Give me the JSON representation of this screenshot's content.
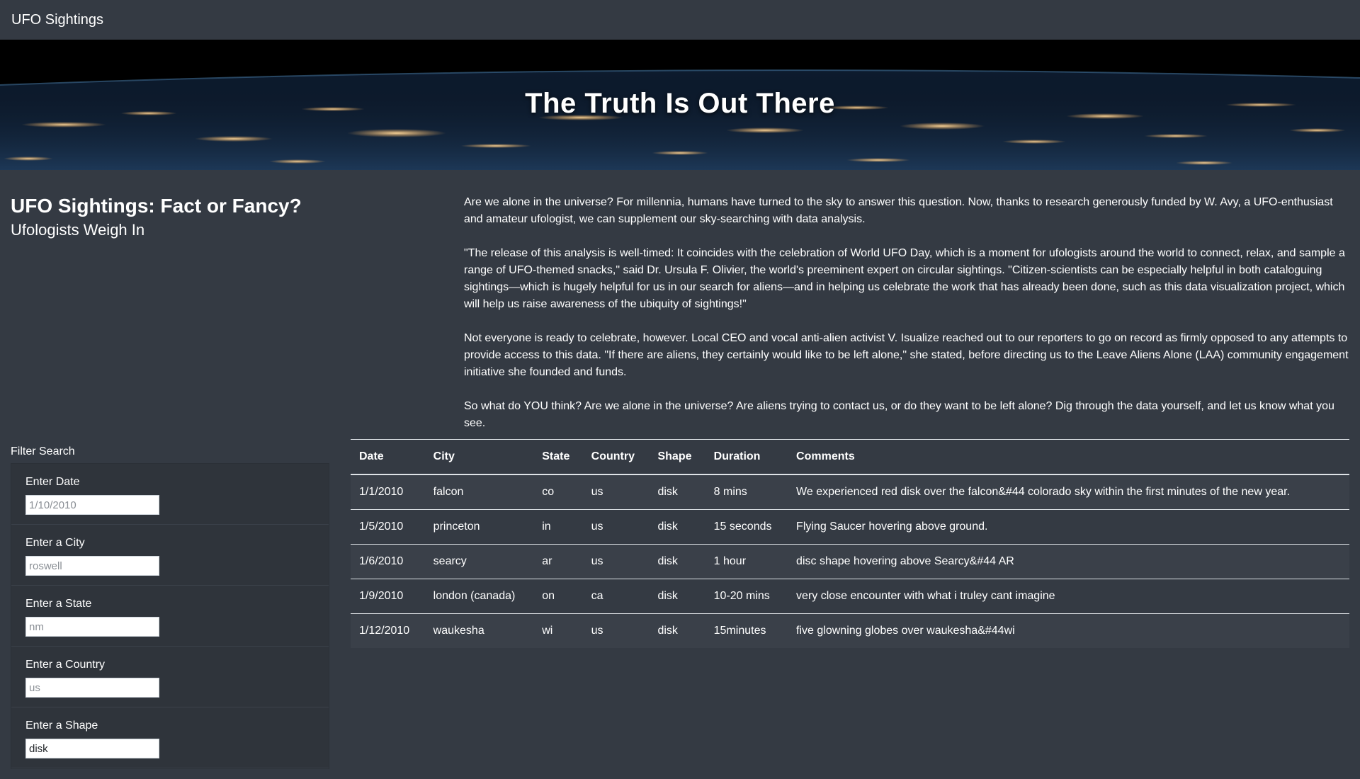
{
  "navbar": {
    "brand": "UFO Sightings"
  },
  "hero": {
    "title": "The Truth Is Out There"
  },
  "intro": {
    "title": "UFO Sightings: Fact or Fancy?",
    "subtitle": "Ufologists Weigh In"
  },
  "article": {
    "paragraphs": [
      "Are we alone in the universe? For millennia, humans have turned to the sky to answer this question. Now, thanks to research generously funded by W. Avy, a UFO-enthusiast and amateur ufologist, we can supplement our sky-searching with data analysis.",
      "\"The release of this analysis is well-timed: It coincides with the celebration of World UFO Day, which is a moment for ufologists around the world to connect, relax, and sample a range of UFO-themed snacks,\" said Dr. Ursula F. Olivier, the world's preeminent expert on circular sightings. \"Citizen-scientists can be especially helpful in both cataloguing sightings—which is hugely helpful for us in our search for aliens—and in helping us celebrate the work that has already been done, such as this data visualization project, which will help us raise awareness of the ubiquity of sightings!\"",
      "Not everyone is ready to celebrate, however. Local CEO and vocal anti-alien activist V. Isualize reached out to our reporters to go on record as firmly opposed to any attempts to provide access to this data. \"If there are aliens, they certainly would like to be left alone,\" she stated, before directing us to the Leave Aliens Alone (LAA) community engagement initiative she founded and funds.",
      "So what do YOU think? Are we alone in the universe? Are aliens trying to contact us, or do they want to be left alone? Dig through the data yourself, and let us know what you see."
    ]
  },
  "filters": {
    "title": "Filter Search",
    "items": [
      {
        "label": "Enter Date",
        "placeholder": "1/10/2010",
        "value": ""
      },
      {
        "label": "Enter a City",
        "placeholder": "roswell",
        "value": ""
      },
      {
        "label": "Enter a State",
        "placeholder": "nm",
        "value": ""
      },
      {
        "label": "Enter a Country",
        "placeholder": "us",
        "value": ""
      },
      {
        "label": "Enter a Shape",
        "placeholder": "",
        "value": "disk"
      }
    ]
  },
  "table": {
    "columns": [
      "Date",
      "City",
      "State",
      "Country",
      "Shape",
      "Duration",
      "Comments"
    ],
    "rows": [
      [
        "1/1/2010",
        "falcon",
        "co",
        "us",
        "disk",
        "8 mins",
        "We experienced red disk over the falcon&#44 colorado sky within the first minutes of the new year."
      ],
      [
        "1/5/2010",
        "princeton",
        "in",
        "us",
        "disk",
        "15 seconds",
        "Flying Saucer hovering above ground."
      ],
      [
        "1/6/2010",
        "searcy",
        "ar",
        "us",
        "disk",
        "1 hour",
        "disc shape hovering above Searcy&#44 AR"
      ],
      [
        "1/9/2010",
        "london (canada)",
        "on",
        "ca",
        "disk",
        "10-20 mins",
        "very close encounter with what i truley cant imagine"
      ],
      [
        "1/12/2010",
        "waukesha",
        "wi",
        "us",
        "disk",
        "15minutes",
        "five glowning globes over waukesha&#44wi"
      ]
    ]
  }
}
